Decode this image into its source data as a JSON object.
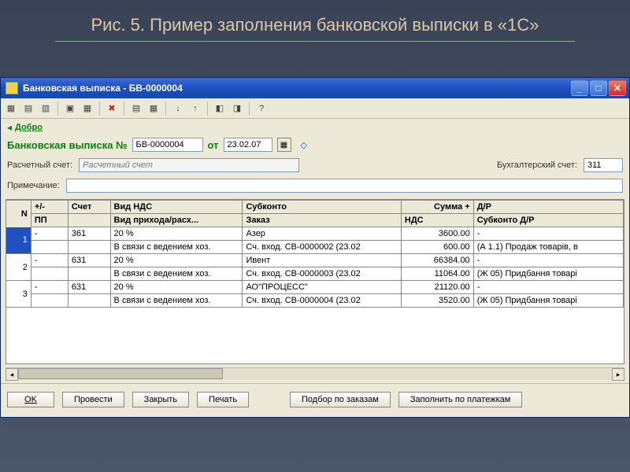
{
  "slide": {
    "title": "Рис. 5. Пример заполнения банковской выписки в «1С»"
  },
  "window": {
    "title": "Банковская выписка - БВ-0000004",
    "dobro_label": "Добро",
    "bank_label": "Банковская выписка №",
    "doc_no": "БВ-0000004",
    "date_label": "от",
    "date": "23.02.07",
    "rs_label": "Расчетный счет:",
    "rs_value": "Расчетный счет",
    "bs_label": "Бухгалтерский счет:",
    "bs_value": "311",
    "note_label": "Примечание:",
    "note_value": ""
  },
  "buttons": {
    "ok": "OK",
    "provesti": "Провести",
    "zakryt": "Закрыть",
    "pechat": "Печать",
    "podbor": "Подбор по заказам",
    "zapolnit": "Заполнить по платежкам"
  },
  "table": {
    "headers": {
      "n": "N",
      "pm": "+/-",
      "pp": "ПП",
      "schet": "Счет",
      "vid_nds": "Вид НДС",
      "vid_pr": "Вид прихода/расх...",
      "subkonto": "Субконто",
      "zakaz": "Заказ",
      "summa": "Сумма +",
      "nds": "НДС",
      "dr": "Д/Р",
      "subdr": "Субконто Д/Р"
    },
    "rows": [
      {
        "n": "1",
        "pm": "-",
        "schet": "361",
        "vid_nds": "20 %",
        "vid_pr": "В связи с ведением хоз.",
        "subkonto": "Азер",
        "zakaz": "Сч. вход. СВ-0000002 (23.02",
        "summa": "3600.00",
        "nds": "600.00",
        "dr": "-",
        "subdr": "(А 1.1) Продаж товарів, в"
      },
      {
        "n": "2",
        "pm": "-",
        "schet": "631",
        "vid_nds": "20 %",
        "vid_pr": "В связи с ведением хоз.",
        "subkonto": "Ивент",
        "zakaz": "Сч. вход. СВ-0000003 (23.02",
        "summa": "66384.00",
        "nds": "11064.00",
        "dr": "-",
        "subdr": "(Ж 05) Придбання товарі"
      },
      {
        "n": "3",
        "pm": "-",
        "schet": "631",
        "vid_nds": "20 %",
        "vid_pr": "В связи с ведением хоз.",
        "subkonto": "АО\"ПРОЦЕСС\"",
        "zakaz": "Сч. вход. СВ-0000004 (23.02",
        "summa": "21120.00",
        "nds": "3520.00",
        "dr": "-",
        "subdr": "(Ж 05) Придбання товарі"
      }
    ]
  }
}
